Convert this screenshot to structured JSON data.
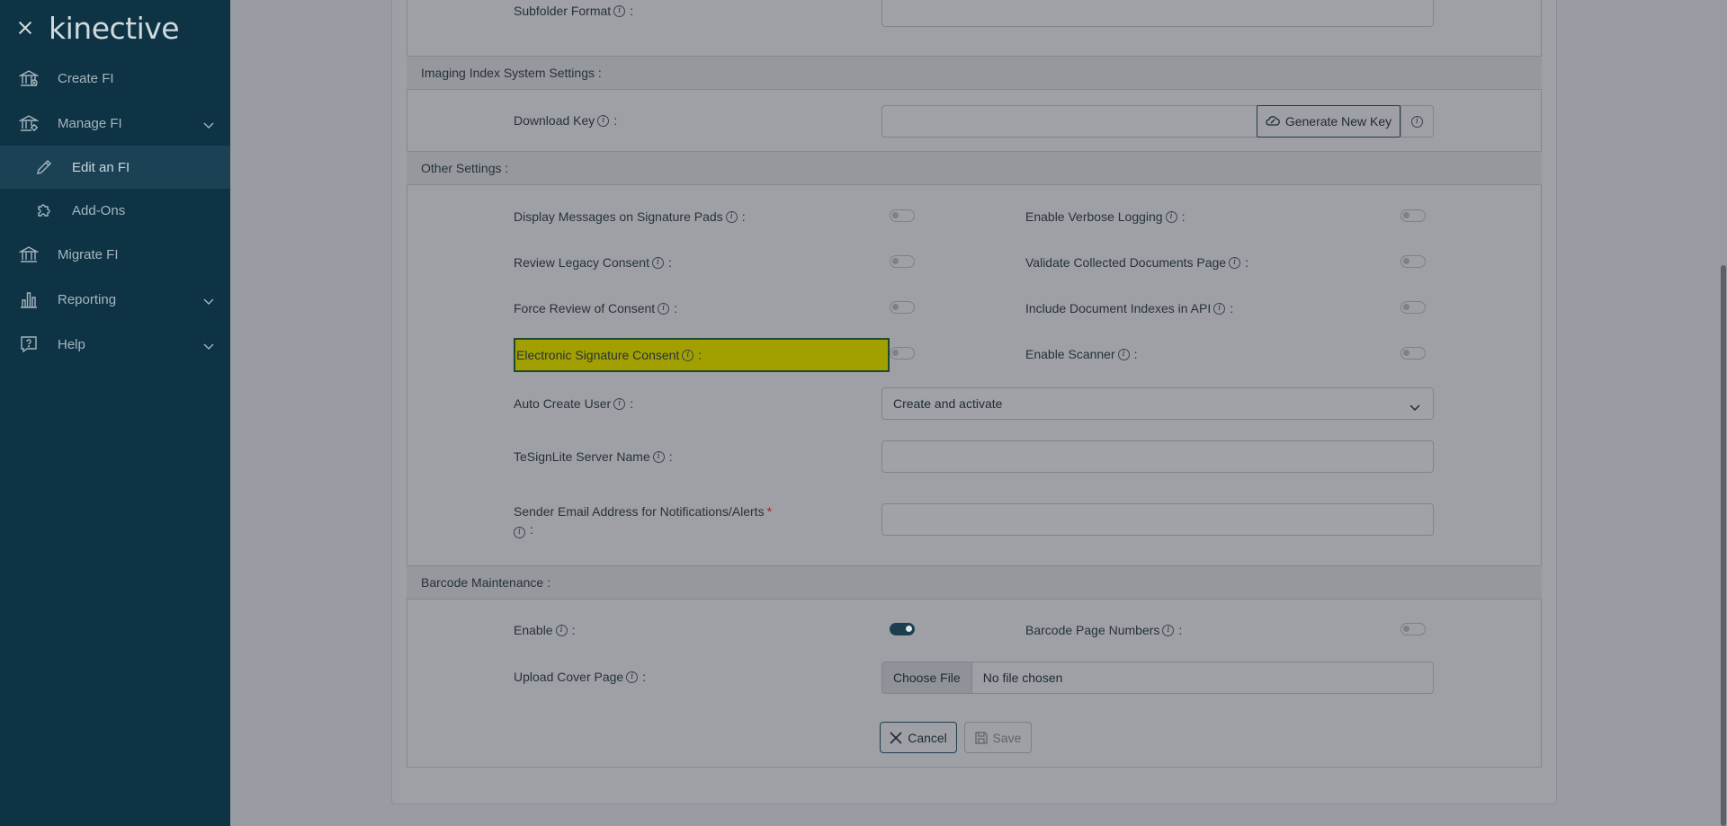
{
  "sidebar": {
    "logo": "kinective",
    "items": [
      {
        "label": "Create FI",
        "icon": "bank-icon"
      },
      {
        "label": "Manage FI",
        "icon": "bank-gear-icon"
      },
      {
        "label": "Edit an FI",
        "icon": "pencil-icon"
      },
      {
        "label": "Add-Ons",
        "icon": "puzzle-icon"
      },
      {
        "label": "Migrate FI",
        "icon": "bank-icon"
      },
      {
        "label": "Reporting",
        "icon": "bar-chart-icon"
      },
      {
        "label": "Help",
        "icon": "help-icon"
      }
    ]
  },
  "form": {
    "subfolder_format_label": "Subfolder Format",
    "sections": {
      "imaging": "Imaging Index System Settings :",
      "other": "Other Settings :",
      "barcode": "Barcode Maintenance :"
    },
    "download_key_label": "Download Key",
    "generate_key_label": "Generate New Key",
    "other": {
      "display_messages": "Display Messages on Signature Pads",
      "enable_verbose": "Enable Verbose Logging",
      "review_legacy": "Review Legacy Consent",
      "validate_docs": "Validate Collected Documents Page",
      "force_review": "Force Review of Consent",
      "include_indexes": "Include Document Indexes in API",
      "electronic_sig": "Electronic Signature Consent",
      "enable_scanner": "Enable Scanner",
      "auto_create_user": "Auto Create User",
      "auto_create_value": "Create and activate",
      "tesign_server": "TeSignLite Server Name",
      "sender_email": "Sender Email Address for Notifications/Alerts",
      "required_mark": "*"
    },
    "barcode": {
      "enable": "Enable",
      "page_numbers": "Barcode Page Numbers",
      "upload_cover": "Upload Cover Page",
      "choose_file": "Choose File",
      "no_file": "No file chosen"
    },
    "toggles": {
      "barcode_enable": true
    },
    "buttons": {
      "cancel": "Cancel",
      "save": "Save"
    }
  }
}
